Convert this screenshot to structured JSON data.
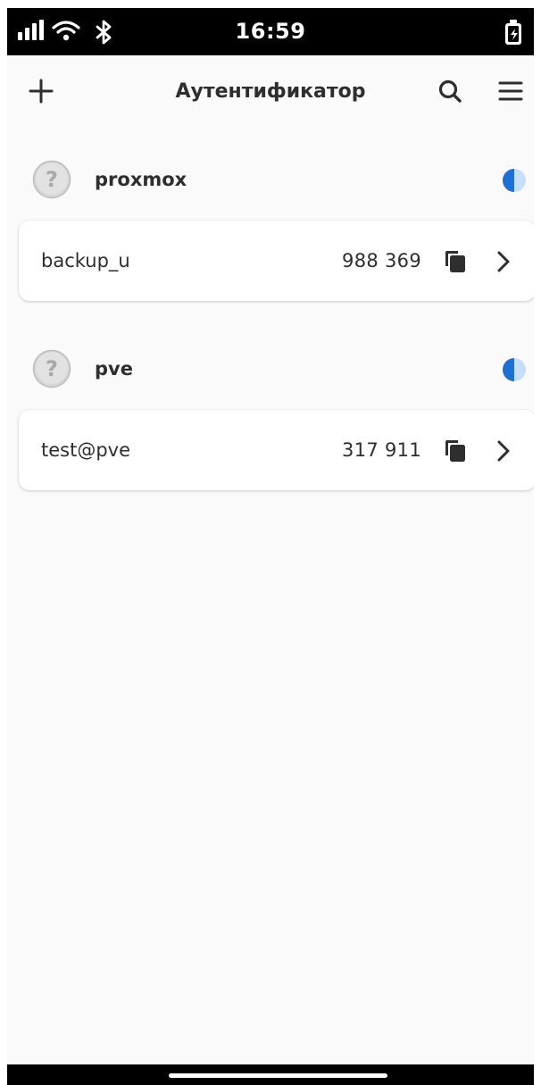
{
  "status_bar": {
    "time": "16:59",
    "icons": [
      "signal-icon",
      "wifi-icon",
      "bluetooth-icon",
      "battery-charging-icon"
    ]
  },
  "header": {
    "title": "Аутентификатор",
    "add_icon": "plus-icon",
    "search_icon": "search-icon",
    "menu_icon": "hamburger-menu-icon"
  },
  "colors": {
    "background": "#fafafa",
    "card": "#ffffff",
    "text": "#2e2e2e",
    "accent": "#1c71d8",
    "timer_track": "#c8ddf7",
    "avatar": "#d6d6d6"
  },
  "groups": [
    {
      "name": "proxmox",
      "avatar_icon": "question-mark-icon",
      "timer_remaining": 0.5,
      "accounts": [
        {
          "name": "backup_u",
          "code": "988 369"
        }
      ]
    },
    {
      "name": "pve",
      "avatar_icon": "question-mark-icon",
      "timer_remaining": 0.5,
      "accounts": [
        {
          "name": "test@pve",
          "code": "317 911"
        }
      ]
    }
  ]
}
